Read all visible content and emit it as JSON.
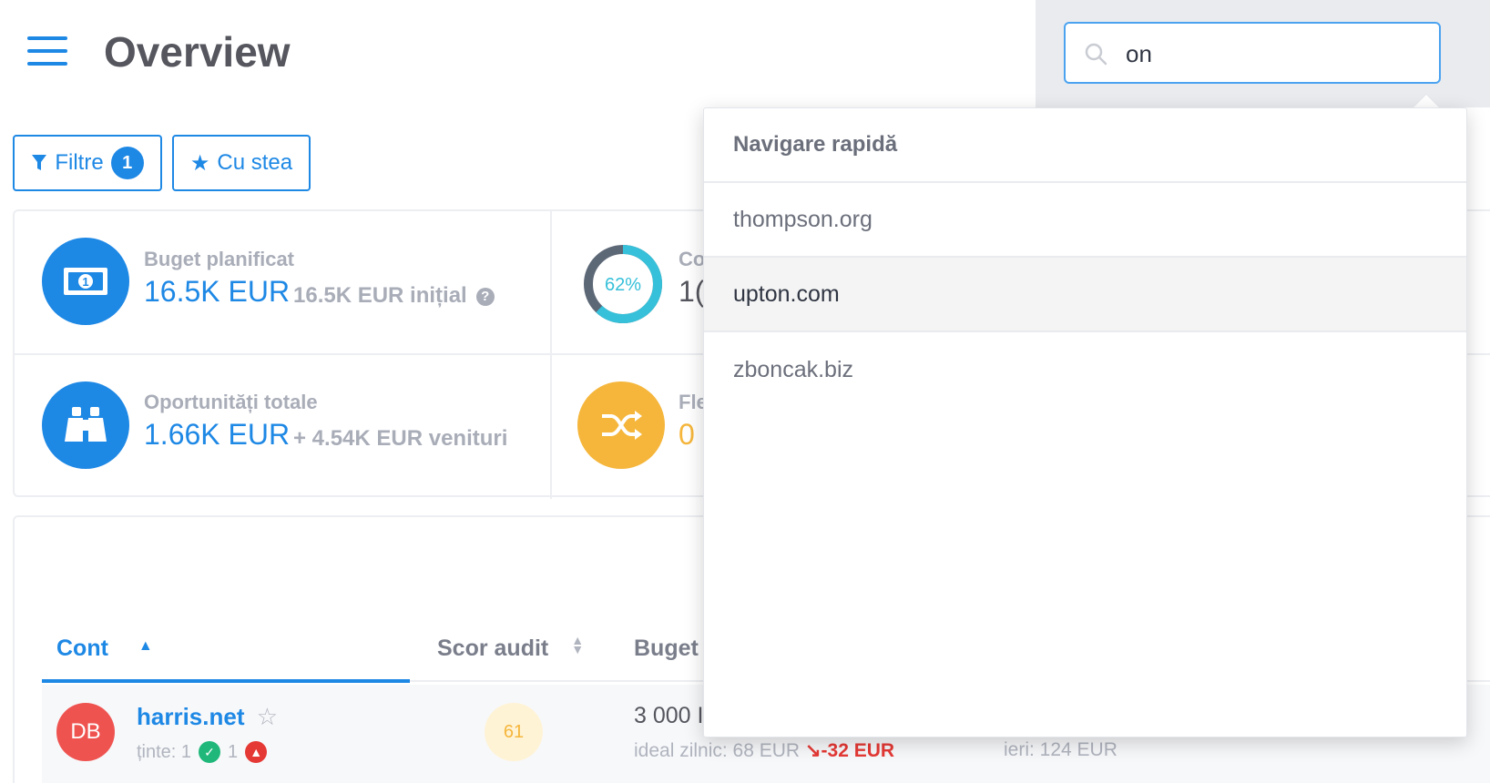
{
  "header": {
    "title": "Overview",
    "search": {
      "value": "on",
      "placeholder": ""
    }
  },
  "filters": {
    "filter_label": "Filtre",
    "filter_count": "1",
    "starred_label": "Cu stea"
  },
  "stats": [
    {
      "label": "Buget planificat",
      "value": "16.5K EUR",
      "sub": "16.5K EUR inițial",
      "icon": "banknote-icon",
      "color": "#1e88e5"
    },
    {
      "label": "Co",
      "value": "1(",
      "sub": "",
      "icon": "donut-progress",
      "progress_percent": 62,
      "progress_label": "62%",
      "color": "#36c0d9"
    },
    {
      "label": "Oportunități totale",
      "value": "1.66K EUR",
      "sub": "+ 4.54K EUR venituri",
      "icon": "binoculars-icon",
      "color": "#1e88e5"
    },
    {
      "label": "Fle",
      "value": "0",
      "sub": "",
      "icon": "shuffle-icon",
      "color": "#f5b63b"
    }
  ],
  "table": {
    "columns": [
      {
        "label": "Cont",
        "sort": "asc"
      },
      {
        "label": "Scor audit",
        "sort": "none"
      },
      {
        "label": "Buget"
      }
    ],
    "rows": [
      {
        "initials": "DB",
        "account": "harris.net",
        "targets_label": "ținte: 1",
        "ok_count": "1",
        "score": "61",
        "budget": "3 000 I",
        "ideal_daily": "ideal zilnic: 68 EUR",
        "delta": "↘-32 EUR",
        "yesterday": "ieri: 124 EUR"
      }
    ]
  },
  "quick_nav": {
    "title": "Navigare rapidă",
    "items": [
      "thompson.org",
      "upton.com",
      "zboncak.biz"
    ],
    "highlighted_index": 1
  },
  "colors": {
    "accent": "#1e88e5",
    "danger": "#e53935",
    "success": "#1fb87a",
    "warning": "#f5b63b"
  }
}
